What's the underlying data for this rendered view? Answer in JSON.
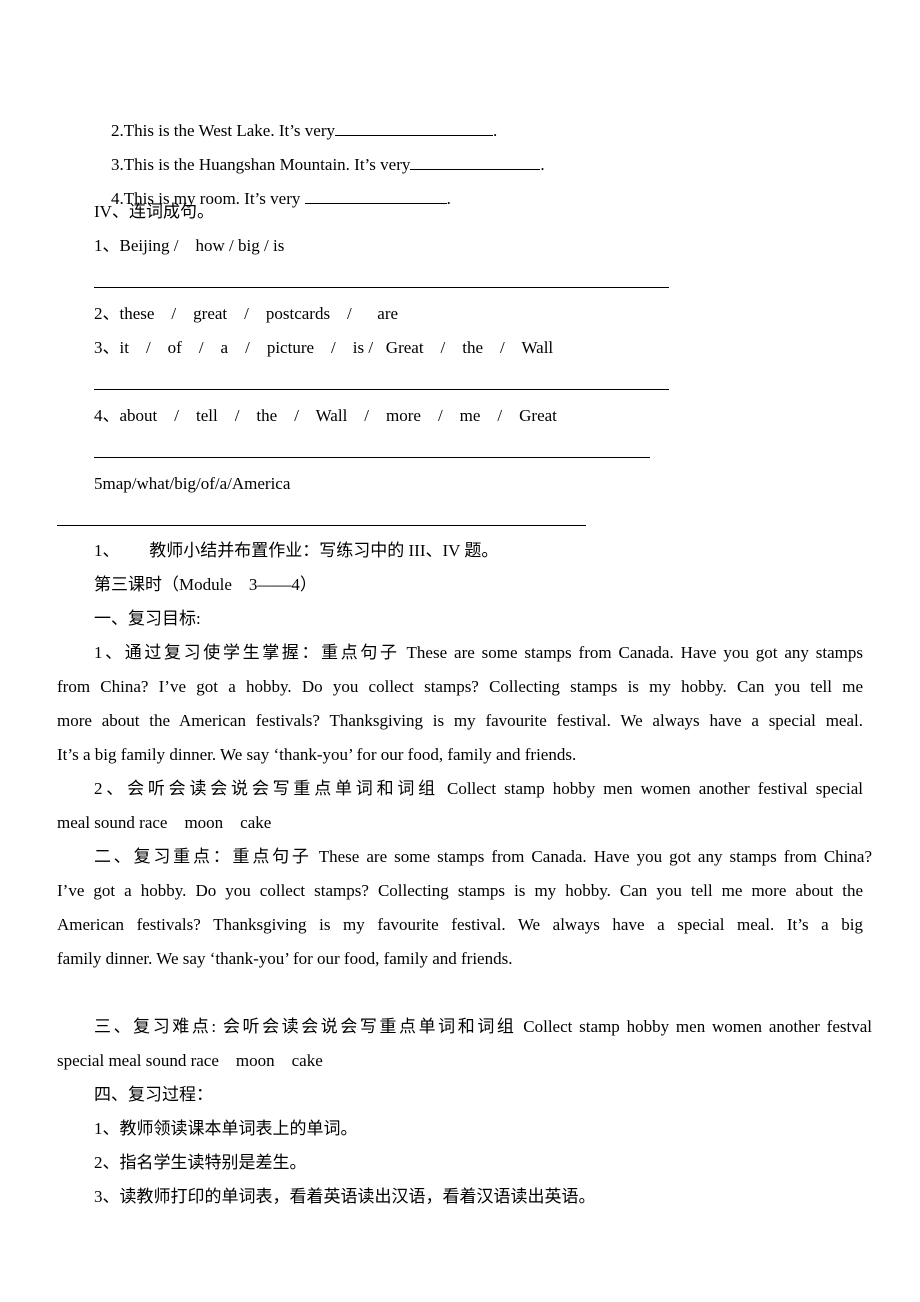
{
  "exercise_iii": {
    "q2": "2.This is the West Lake. It’s very",
    "q3": "3.This is the Huangshan Mountain. It’s very",
    "q4": "4.This is my room. It’s very ",
    "period": "."
  },
  "exercise_iv": {
    "heading": "IV、连词成句。",
    "items": [
      "1、Beijing /    how / big / is",
      "2、these    /    great    /    postcards    /      are",
      "3、it    /    of    /    a    /    picture    /    is /   Great    /    the    /    Wall",
      "4、about    /    tell    /    the    /    Wall    /    more    /    me    /    Great",
      "5map/what/big/of/a/America"
    ]
  },
  "summary": "1、       教师小结并布置作业：写练习中的 III、IV 题。",
  "lesson3": {
    "title": "第三课时（Module    3——4）",
    "goals_heading": "一、复习目标:",
    "goal1": [
      "1、通过复习使学生掌握：重点句子 These are some stamps from Canada. Have you got any stamps",
      "from China? I’ve got a hobby. Do you collect stamps? Collecting stamps is my hobby. Can you tell me",
      "more about the American festivals? Thanksgiving is my favourite    festival. We always have a special meal.",
      "It’s a big family dinner. We say ‘thank-you’ for our food, family and friends."
    ],
    "goal2": [
      "2、会听会读会说会写重点单词和词组 Collect stamp hobby men women    another festival special",
      "meal sound race    moon    cake"
    ],
    "key_points": [
      "二、复习重点：重点句子 These are some stamps from Canada. Have you got any stamps from China?",
      "I’ve got a hobby. Do you collect stamps? Collecting stamps is my hobby. Can you tell me more about the",
      "American festivals? Thanksgiving is my favourite    festival. We always have a special meal. It’s a big",
      "family dinner. We say ‘thank-you’ for our food, family and friends."
    ],
    "difficulties": [
      "三、复习难点: 会听会读会说会写重点单词和词组 Collect stamp hobby men women    another festval",
      "special meal sound race    moon    cake"
    ],
    "process_heading": "四、复习过程：",
    "process": [
      "1、教师领读课本单词表上的单词。",
      "2、指名学生读特别是差生。",
      "3、读教师打印的单词表，看着英语读出汉语，看着汉语读出英语。"
    ]
  }
}
